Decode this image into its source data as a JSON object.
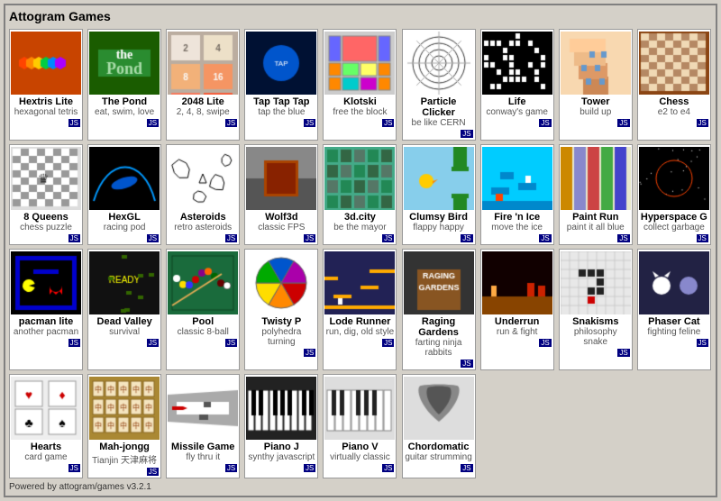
{
  "title": "Attogram Games",
  "powered": "Powered by attogram/games v3.2.1",
  "games": [
    {
      "id": "hextris",
      "title": "Hextris Lite",
      "subtitle": "hexagonal tetris",
      "badge": "JS",
      "color": "#c84400",
      "color2": "#ffaa00"
    },
    {
      "id": "pond",
      "title": "The Pond",
      "subtitle": "eat, swim, love",
      "badge": "JS",
      "color": "#1a5c00",
      "color2": "#3a9c20"
    },
    {
      "id": "2048",
      "title": "2048 Lite",
      "subtitle": "2, 4, 8, swipe",
      "badge": "JS",
      "color": "#f9f6f2",
      "color2": "#ccc"
    },
    {
      "id": "taptap",
      "title": "Tap Tap Tap",
      "subtitle": "tap the blue",
      "badge": "JS",
      "color": "#001133",
      "color2": "#0033aa"
    },
    {
      "id": "klotski",
      "title": "Klotski",
      "subtitle": "free the block",
      "badge": "JS",
      "color": "#cccccc",
      "color2": "#888"
    },
    {
      "id": "particle",
      "title": "Particle Clicker",
      "subtitle": "be like CERN",
      "badge": "JS",
      "color": "#ffffff",
      "color2": "#ddd"
    },
    {
      "id": "life",
      "title": "Life",
      "subtitle": "conway's game",
      "badge": "JS",
      "color": "#000000",
      "color2": "#00ff00"
    },
    {
      "id": "tower",
      "title": "Tower",
      "subtitle": "build up",
      "badge": "JS",
      "color": "#f8d8b0",
      "color2": "#e09060"
    },
    {
      "id": "chess",
      "title": "Chess",
      "subtitle": "e2 to e4",
      "badge": "JS",
      "color": "#8b4513",
      "color2": "#deb887"
    },
    {
      "id": "8queens",
      "title": "8 Queens",
      "subtitle": "chess puzzle",
      "badge": "JS",
      "color": "#dddddd",
      "color2": "#888"
    },
    {
      "id": "hexgl",
      "title": "HexGL",
      "subtitle": "racing pod",
      "badge": "JS",
      "color": "#000033",
      "color2": "#0099ff"
    },
    {
      "id": "asteroids",
      "title": "Asteroids",
      "subtitle": "retro asteroids",
      "badge": "JS",
      "color": "#ffffff",
      "color2": "#000"
    },
    {
      "id": "wolf3d",
      "title": "Wolf3d",
      "subtitle": "classic FPS",
      "badge": "JS",
      "color": "#333333",
      "color2": "#888"
    },
    {
      "id": "3dcity",
      "title": "3d.city",
      "subtitle": "be the mayor",
      "badge": "JS",
      "color": "#44aa88",
      "color2": "#228855"
    },
    {
      "id": "clumsy",
      "title": "Clumsy Bird",
      "subtitle": "flappy happy",
      "badge": "JS",
      "color": "#87ceeb",
      "color2": "#5588cc"
    },
    {
      "id": "firnice",
      "title": "Fire 'n Ice",
      "subtitle": "move the ice",
      "badge": "JS",
      "color": "#00ccff",
      "color2": "#0088cc"
    },
    {
      "id": "paintrun",
      "title": "Paint Run",
      "subtitle": "paint it all blue",
      "badge": "JS",
      "color": "#cccc88",
      "color2": "#8888cc"
    },
    {
      "id": "hyper",
      "title": "Hyperspace G",
      "subtitle": "collect garbage",
      "badge": "JS",
      "color": "#000000",
      "color2": "#cc0000"
    },
    {
      "id": "pacman",
      "title": "pacman lite",
      "subtitle": "another pacman",
      "badge": "JS",
      "color": "#000000",
      "color2": "#ffff00"
    },
    {
      "id": "dead",
      "title": "Dead Valley",
      "subtitle": "survival",
      "badge": "JS",
      "color": "#111111",
      "color2": "#336600"
    },
    {
      "id": "pool",
      "title": "Pool",
      "subtitle": "classic 8-ball",
      "badge": "JS",
      "color": "#1a6b3c",
      "color2": "#ffffff"
    },
    {
      "id": "twisty",
      "title": "Twisty P",
      "subtitle": "polyhedra turning",
      "badge": "JS",
      "color": "#ffffff",
      "color2": "#cc4400"
    },
    {
      "id": "lode",
      "title": "Lode Runner",
      "subtitle": "run, dig, old style",
      "badge": "JS",
      "color": "#222255",
      "color2": "#ffaa00"
    },
    {
      "id": "raging",
      "title": "Raging Gardens",
      "subtitle": "farting ninja rabbits",
      "badge": "JS",
      "color": "#333333",
      "color2": "#885522"
    },
    {
      "id": "underrun",
      "title": "Underrun",
      "subtitle": "run & fight",
      "badge": "JS",
      "color": "#110000",
      "color2": "#884400"
    },
    {
      "id": "snakisms",
      "title": "Snakisms",
      "subtitle": "philosophy snake",
      "badge": "JS",
      "color": "#e8e8e8",
      "color2": "#222"
    },
    {
      "id": "phaser",
      "title": "Phaser Cat",
      "subtitle": "fighting feline",
      "badge": "JS",
      "color": "#222244",
      "color2": "#8888cc"
    },
    {
      "id": "hearts",
      "title": "Hearts",
      "subtitle": "card game",
      "badge": "JS",
      "color": "#eeeeee",
      "color2": "#cc0000"
    },
    {
      "id": "mahjongg",
      "title": "Mah-jongg",
      "subtitle": "Tianjin 天津麻将",
      "badge": "JS",
      "color": "#aa8833",
      "color2": "#665500"
    },
    {
      "id": "missile",
      "title": "Missile Game",
      "subtitle": "fly thru it",
      "badge": "JS",
      "color": "#ffffff",
      "color2": "#333"
    },
    {
      "id": "pianoj",
      "title": "Piano J",
      "subtitle": "synthy javascript",
      "badge": "JS",
      "color": "#222222",
      "color2": "#ffffff"
    },
    {
      "id": "pianv",
      "title": "Piano V",
      "subtitle": "virtually classic",
      "badge": "JS",
      "color": "#dddddd",
      "color2": "#222"
    },
    {
      "id": "chordo",
      "title": "Chordomatic",
      "subtitle": "guitar strumming",
      "badge": "JS",
      "color": "#dddddd",
      "color2": "#333"
    }
  ]
}
